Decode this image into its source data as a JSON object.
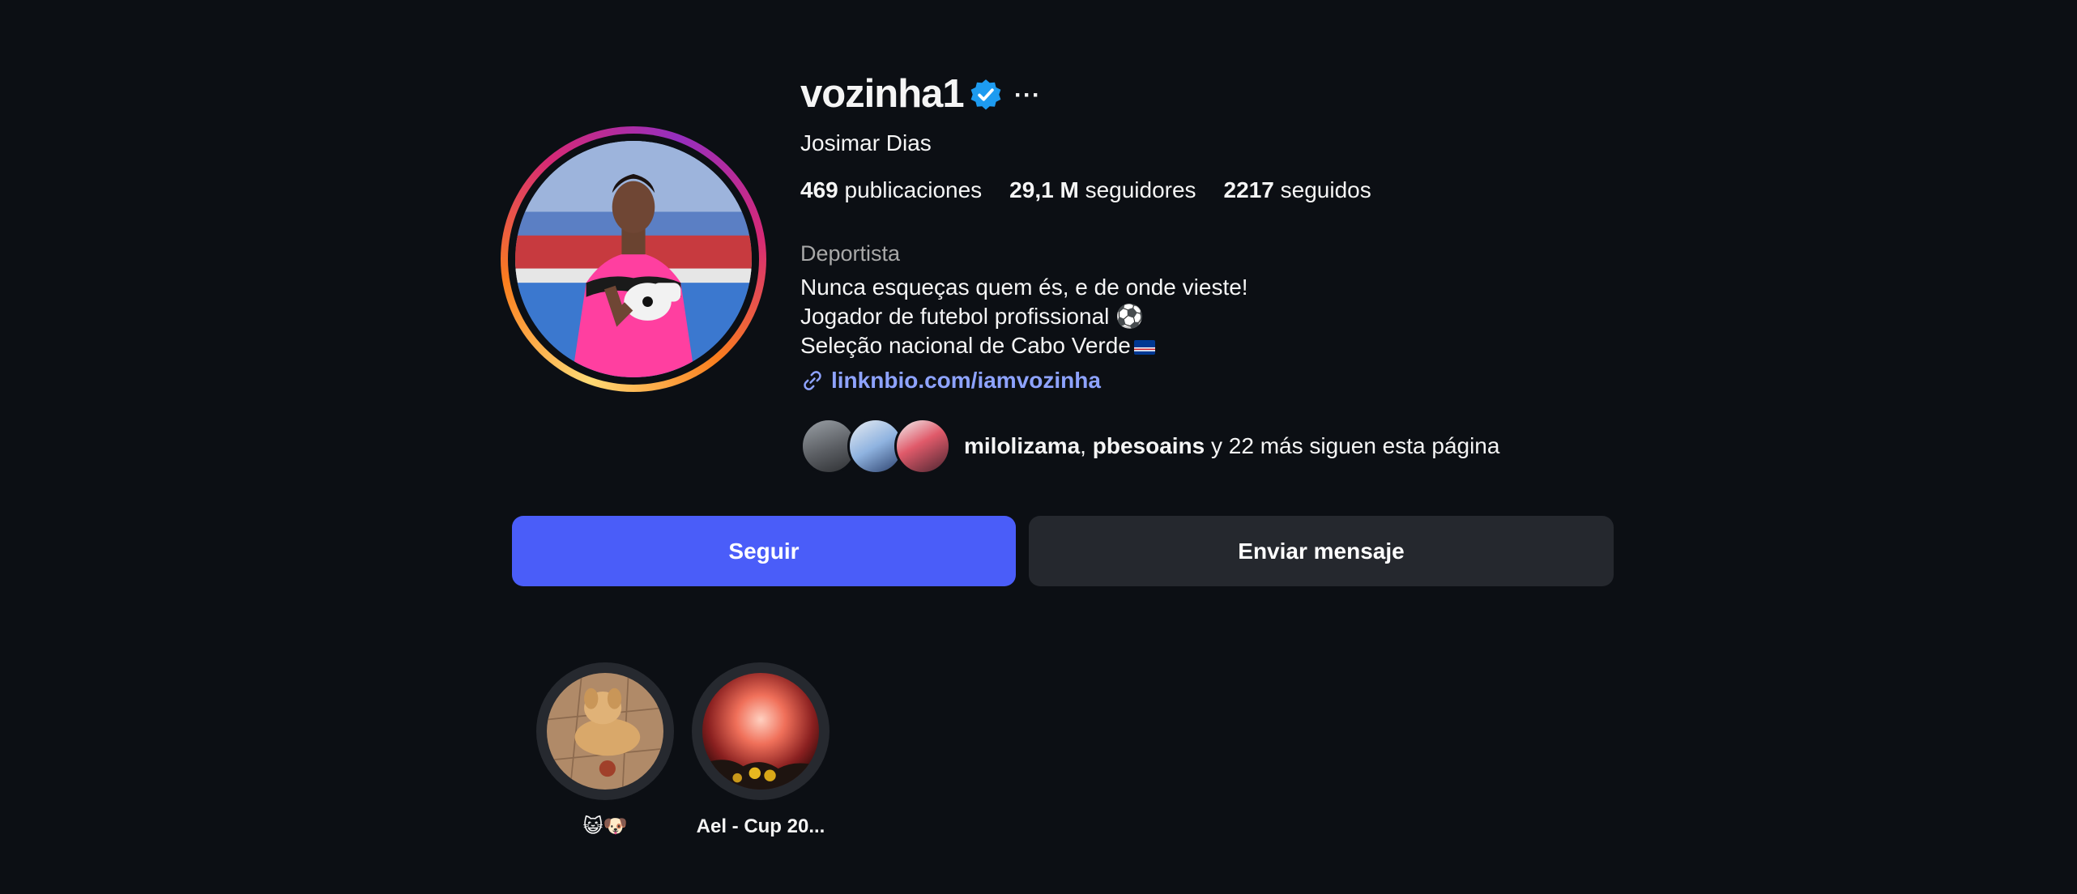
{
  "profile": {
    "username": "vozinha1",
    "full_name": "Josimar Dias",
    "category": "Deportista",
    "bio_lines": [
      "Nunca esqueças quem és, e de onde vieste!",
      "Jogador de futebol profissional ⚽",
      "Seleção nacional de Cabo Verde"
    ],
    "link": "linknbio.com/iamvozinha",
    "icons": {
      "verified": "verified-badge-icon",
      "more": "more-options-icon",
      "link": "link-icon",
      "flag": "cape-verde-flag-icon"
    }
  },
  "stats": {
    "posts_value": "469",
    "posts_label": "publicaciones",
    "followers_value": "29,1 M",
    "followers_label": "seguidores",
    "following_value": "2217",
    "following_label": "seguidos"
  },
  "followed_by": {
    "user1": "milolizama",
    "separator": ",",
    "user2": "pbesoains",
    "suffix": "y 22 más siguen esta página"
  },
  "actions": {
    "follow_label": "Seguir",
    "message_label": "Enviar mensaje"
  },
  "highlights": [
    {
      "label": "😺🐶"
    },
    {
      "label": "Ael - Cup 20..."
    }
  ],
  "colors": {
    "background": "#0c0f14",
    "primary_button": "#4a5df9",
    "secondary_button": "#25282e",
    "link": "#8ea3ff",
    "verified": "#1d9bf0"
  }
}
